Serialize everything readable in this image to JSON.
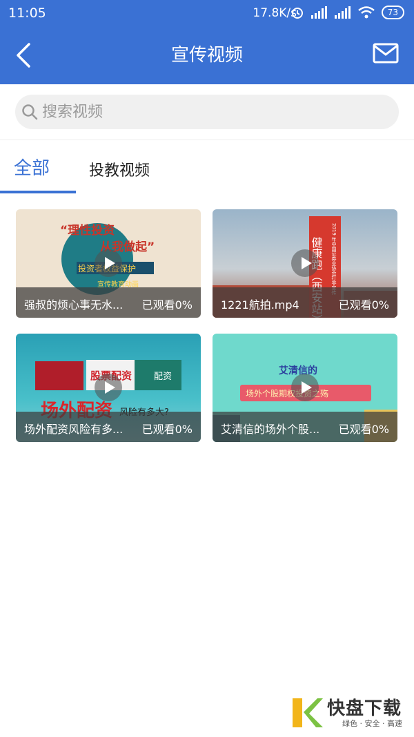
{
  "status_bar": {
    "time": "11:05",
    "net_speed": "17.8K/s",
    "battery": "73"
  },
  "nav": {
    "title": "宣传视频"
  },
  "search": {
    "placeholder": "搜索视频"
  },
  "tabs": [
    {
      "label": "全部",
      "active": true
    },
    {
      "label": "投教视频",
      "active": false
    }
  ],
  "videos": [
    {
      "title": "强叔的烦心事无水...",
      "progress": "已观看0%",
      "thumb_texts": [
        "“理性投资",
        "从我做起”",
        "投资者权益保护",
        "宣传教育动画"
      ]
    },
    {
      "title": "1221航拍.mp4",
      "progress": "已观看0%",
      "thumb_texts": [
        "健康跑（西安站）",
        "2019 年中国证券业协会打非宣传"
      ]
    },
    {
      "title": "场外配资风险有多...",
      "progress": "已观看0%",
      "thumb_texts": [
        "股票配资",
        "配资",
        "场外配资",
        "风险有多大?"
      ]
    },
    {
      "title": "艾清信的场外个股...",
      "progress": "已观看0%",
      "thumb_texts": [
        "艾清信的",
        "场外个股期权投资之殇"
      ]
    }
  ],
  "watermark": {
    "name": "快盘下载",
    "tagline": "绿色 · 安全 · 高速"
  },
  "colors": {
    "brand_blue": "#3a71d4",
    "search_bg": "#f0f0f0"
  }
}
